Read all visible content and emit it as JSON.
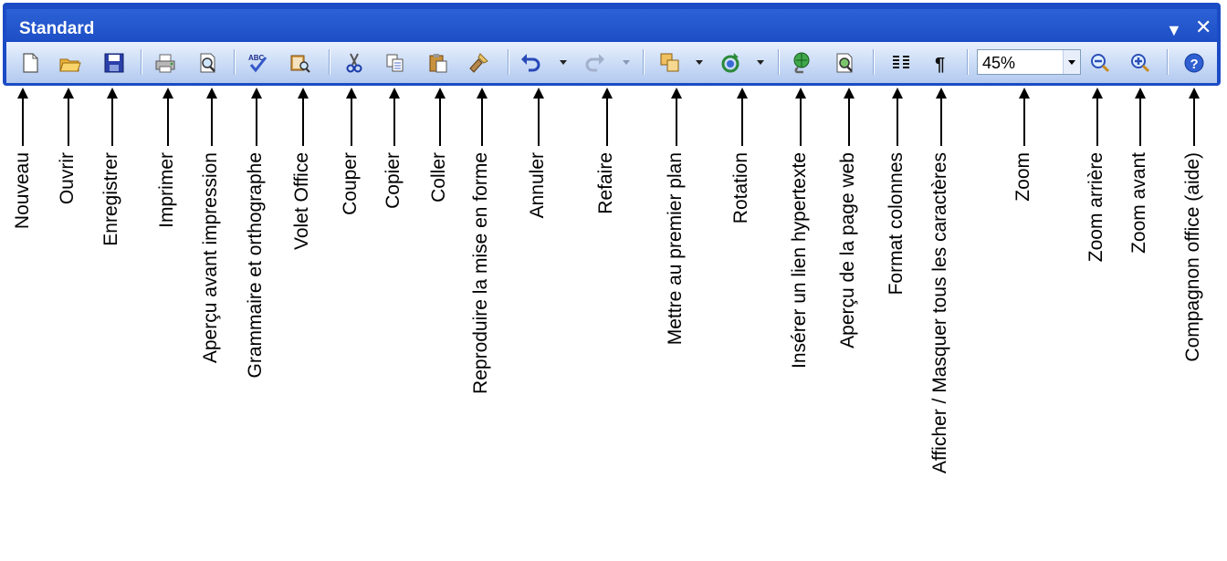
{
  "toolbar": {
    "title": "Standard",
    "dropdown_icon": "chevron-down-icon",
    "close_icon": "close-icon",
    "zoom_value": "45%"
  },
  "labels": {
    "nouveau": "Nouveau",
    "ouvrir": "Ouvrir",
    "enregistrer": "Enregistrer",
    "imprimer": "Imprimer",
    "apercu_impression": "Aperçu avant impression",
    "grammaire": "Grammaire et orthographe",
    "volet": "Volet Office",
    "couper": "Couper",
    "copier": "Copier",
    "coller": "Coller",
    "reproduire": "Reproduire la mise en forme",
    "annuler": "Annuler",
    "refaire": "Refaire",
    "premier_plan": "Mettre au premier plan",
    "rotation": "Rotation",
    "lien": "Insérer un lien hypertexte",
    "apercu_web": "Aperçu de la page web",
    "colonnes": "Format colonnes",
    "afficher": "Afficher / Masquer tous les caractères",
    "zoom": "Zoom",
    "zoom_arriere": "Zoom arrière",
    "zoom_avant": "Zoom avant",
    "compagnon": "Compagnon office (aide)"
  }
}
